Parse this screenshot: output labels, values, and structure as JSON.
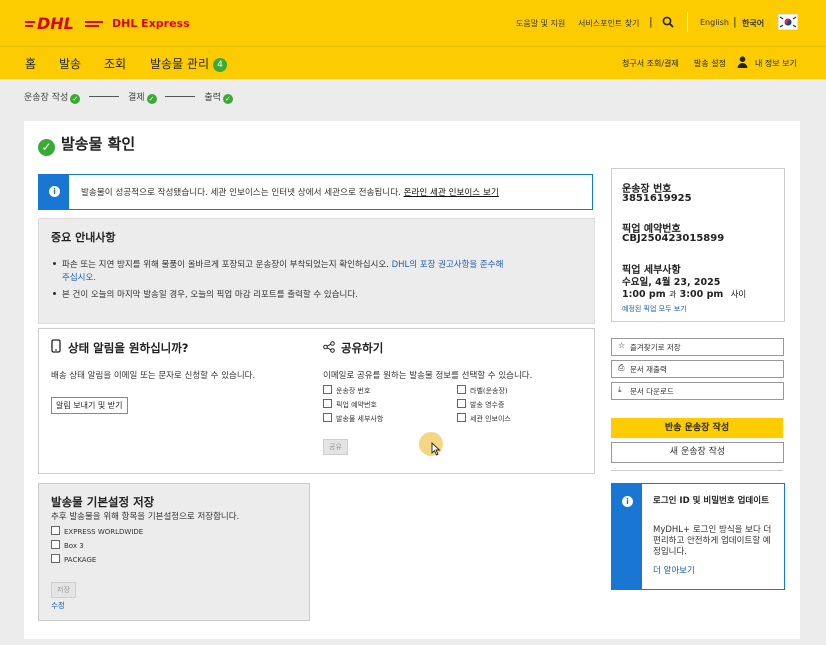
{
  "header": {
    "logo": "DHL",
    "brand": "DHL Express",
    "help": "도움말 및 지원",
    "find_location": "서비스포인트 찾기",
    "lang_en": "English",
    "lang_ko": "한국어",
    "flag": "korea-flag-icon"
  },
  "nav": {
    "home": "홈",
    "ship": "발송",
    "track": "조회",
    "manage": "발송물 관리",
    "manage_badge": "4",
    "billing": "청구서 조회/결제",
    "settings": "발송 설정",
    "profile": "내 정보 보기"
  },
  "steps": {
    "create": "운송장 작성",
    "payment": "결제",
    "print": "출력"
  },
  "page": {
    "title": "발송물 확인"
  },
  "alert": {
    "text": "발송물이 성공적으로 작성됐습니다. 세관 인보이스는 인터넷 상에서 세관으로 전송됩니다.",
    "link": "온라인 세관 인보이스 보기"
  },
  "notice": {
    "title": "중요 안내사항",
    "item1_a": "파손 또는 지연 방지를 위해 물품이 올바르게 포장되고 운송장이 부착되었는지 확인하십시오.",
    "item1_link": "DHL의 포장 권고사항을 준수해",
    "item1_link2": "주십시오.",
    "item2": "본 건이 오늘의 마지막 발송일 경우, 오늘의 픽업 마감 리포트를 출력할 수 있습니다."
  },
  "alerts_section": {
    "title": "상태 알림을 원하십니까?",
    "text": "배송 상태 알림을 이메일 또는 문자로 신청할 수 있습니다.",
    "button": "알림 보내기 및 받기"
  },
  "share_section": {
    "title": "공유하기",
    "text": "이메일로 공유를 원하는 발송물 정보를 선택할 수 있습니다.",
    "options": [
      "운송장 번호",
      "라벨(운송장)",
      "픽업 예약번호",
      "발송 영수증",
      "발송물 세부사항",
      "세관 인보이스"
    ],
    "button": "공유"
  },
  "prefs": {
    "title": "발송물 기본설정 저장",
    "text": "추후 발송물을 위해 항목을 기본설정으로 저장합니다.",
    "options": [
      "EXPRESS WORLDWIDE",
      "Box 3",
      "PACKAGE"
    ],
    "save": "저장",
    "edit": "수정"
  },
  "summary": {
    "waybill_label": "운송장 번호",
    "waybill": "3851619925",
    "pickup_label": "픽업 예약번호",
    "pickup": "CBJ250423015899",
    "details_label": "픽업 세부사항",
    "date": "수요일, 4월 23, 2025",
    "time_from": "1:00 pm",
    "time_to": "3:00 pm",
    "time_sep": "과",
    "time_suffix": "사이",
    "view_all": "예정된 픽업 모두 보기"
  },
  "tools": {
    "bookmark": "즐겨찾기로 저장",
    "reprint": "문서 재출력",
    "download": "문서 다운로드"
  },
  "actions": {
    "return_label": "반송 운송장 작성",
    "new_label": "새 운송장 작성"
  },
  "promo": {
    "title": "로그인 ID 및 비밀번호 업데이트",
    "text": "MyDHL+ 로그인 방식을 보다 더 편리하고 안전하게 업데이트할 예정입니다.",
    "link": "더 알아보기"
  },
  "colors": {
    "yellow": "#fccc00",
    "red": "#d40511",
    "blue": "#1976d2",
    "green": "#3aaa35"
  }
}
